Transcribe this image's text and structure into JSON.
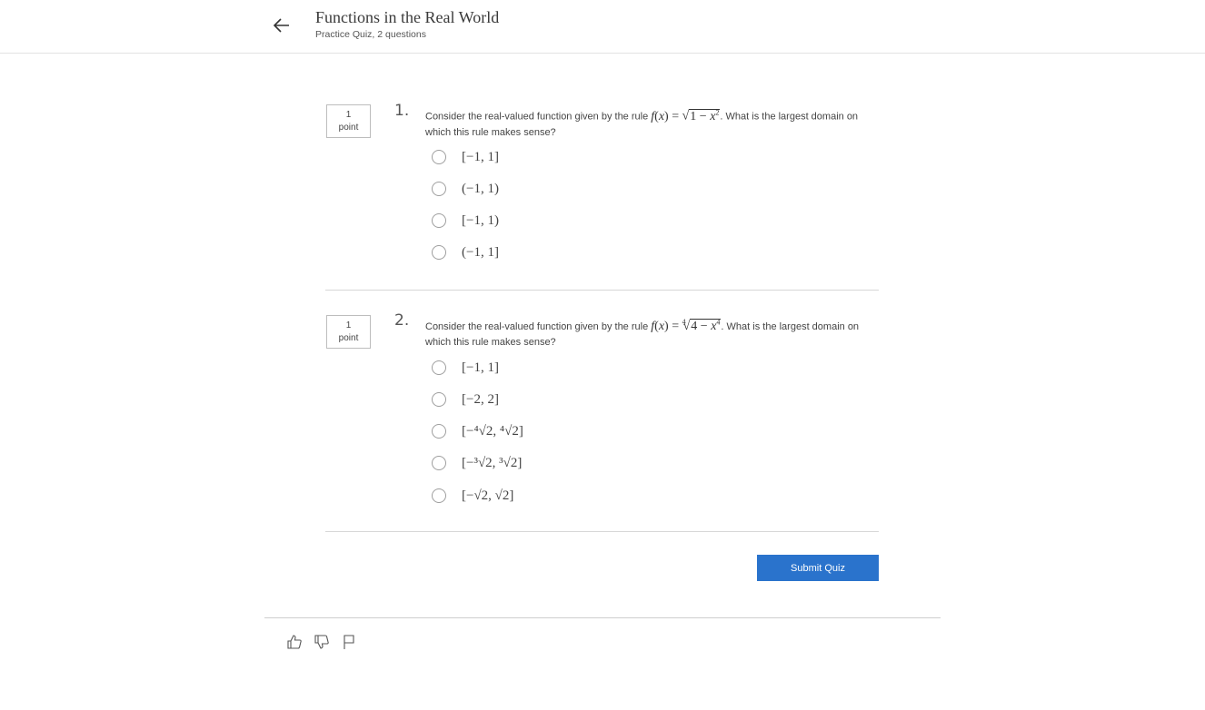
{
  "header": {
    "title": "Functions in the Real World",
    "subtitle": "Practice Quiz, 2 questions",
    "back_icon": "arrow-left-icon"
  },
  "questions": [
    {
      "number": "1.",
      "points_value": "1",
      "points_unit": "point",
      "prompt_before": "Consider the real-valued function given by the rule",
      "prompt_after": ". What is the largest domain on which this rule makes sense?",
      "options": [
        "[−1, 1]",
        "(−1, 1)",
        "[−1, 1)",
        "(−1, 1]"
      ]
    },
    {
      "number": "2.",
      "points_value": "1",
      "points_unit": "point",
      "prompt_before": "Consider the real-valued function given by the rule",
      "prompt_after": ". What is the largest domain on which this rule makes sense?",
      "options": [
        "[−1, 1]",
        "[−2, 2]",
        "[−⁴√2, ⁴√2]",
        "[−³√2, ³√2]",
        "[−√2, √2]"
      ]
    }
  ],
  "submit_label": "Submit Quiz",
  "footer_icons": [
    "thumbs-up-icon",
    "thumbs-down-icon",
    "flag-icon"
  ]
}
